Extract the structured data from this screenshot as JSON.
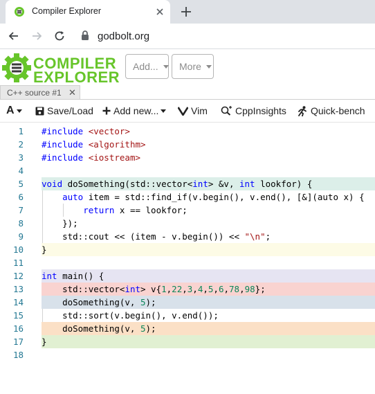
{
  "browser": {
    "tab_title": "Compiler Explorer",
    "url": "godbolt.org"
  },
  "header": {
    "logo_line1": "COMPILER",
    "logo_line2": "EXPLORER",
    "add_label": "Add...",
    "more_label": "More"
  },
  "pane": {
    "tab_label": "C++ source #1",
    "tab_close": "✕"
  },
  "toolbar": {
    "font_label": "A",
    "save_label": "Save/Load",
    "addnew_label": "Add new...",
    "vim_label": "Vim",
    "cppinsights_label": "CppInsights",
    "quickbench_label": "Quick-bench"
  },
  "colors": {
    "accent_green": "#67c52a",
    "line_numbers": "#237893",
    "keyword": "#0000ff",
    "string": "#a31515",
    "number": "#098658"
  },
  "editor": {
    "lines": [
      {
        "n": "1",
        "bg": "",
        "tokens": [
          [
            "dir",
            "#include "
          ],
          [
            "inc",
            "<vector>"
          ]
        ]
      },
      {
        "n": "2",
        "bg": "",
        "tokens": [
          [
            "dir",
            "#include "
          ],
          [
            "inc",
            "<algorithm>"
          ]
        ]
      },
      {
        "n": "3",
        "bg": "",
        "tokens": [
          [
            "dir",
            "#include "
          ],
          [
            "inc",
            "<iostream>"
          ]
        ]
      },
      {
        "n": "4",
        "bg": "",
        "tokens": []
      },
      {
        "n": "5",
        "bg": "#dcefe9",
        "tokens": [
          [
            "kw",
            "void"
          ],
          [
            "fg",
            " doSomething(std::vector<"
          ],
          [
            "kw",
            "int"
          ],
          [
            "fg",
            "> &v, "
          ],
          [
            "kw",
            "int"
          ],
          [
            "fg",
            " lookfor) {"
          ]
        ]
      },
      {
        "n": "6",
        "bg": "",
        "tokens": [
          [
            "fg",
            "    "
          ],
          [
            "kw",
            "auto"
          ],
          [
            "fg",
            " item = std::find_if(v.begin(), v.end(), [&](auto x) {"
          ]
        ]
      },
      {
        "n": "7",
        "bg": "",
        "tokens": [
          [
            "fg",
            "        "
          ],
          [
            "kw",
            "return"
          ],
          [
            "fg",
            " x == lookfor;"
          ]
        ]
      },
      {
        "n": "8",
        "bg": "",
        "tokens": [
          [
            "fg",
            "    });"
          ]
        ]
      },
      {
        "n": "9",
        "bg": "",
        "tokens": [
          [
            "fg",
            "    std::cout << (item - v.begin()) << "
          ],
          [
            "str",
            "\"\\n\""
          ],
          [
            "fg",
            ";"
          ]
        ]
      },
      {
        "n": "10",
        "bg": "#fdfbe6",
        "tokens": [
          [
            "fg",
            "}"
          ]
        ]
      },
      {
        "n": "11",
        "bg": "",
        "tokens": []
      },
      {
        "n": "12",
        "bg": "#e6e4f2",
        "tokens": [
          [
            "kw",
            "int"
          ],
          [
            "fg",
            " main() {"
          ]
        ]
      },
      {
        "n": "13",
        "bg": "#f9d3d0",
        "tokens": [
          [
            "fg",
            "    std::vector<"
          ],
          [
            "kw",
            "int"
          ],
          [
            "fg",
            "> v{"
          ],
          [
            "num",
            "1"
          ],
          [
            "fg",
            ","
          ],
          [
            "num",
            "22"
          ],
          [
            "fg",
            ","
          ],
          [
            "num",
            "3"
          ],
          [
            "fg",
            ","
          ],
          [
            "num",
            "4"
          ],
          [
            "fg",
            ","
          ],
          [
            "num",
            "5"
          ],
          [
            "fg",
            ","
          ],
          [
            "num",
            "6"
          ],
          [
            "fg",
            ","
          ],
          [
            "num",
            "78"
          ],
          [
            "fg",
            ","
          ],
          [
            "num",
            "98"
          ],
          [
            "fg",
            "};"
          ]
        ]
      },
      {
        "n": "14",
        "bg": "#d8e1ea",
        "tokens": [
          [
            "fg",
            "    doSomething(v, "
          ],
          [
            "num",
            "5"
          ],
          [
            "fg",
            ");"
          ]
        ]
      },
      {
        "n": "15",
        "bg": "",
        "tokens": [
          [
            "fg",
            "    std::sort(v.begin(), v.end());"
          ]
        ]
      },
      {
        "n": "16",
        "bg": "#fbe0c6",
        "tokens": [
          [
            "fg",
            "    doSomething(v, "
          ],
          [
            "num",
            "5"
          ],
          [
            "fg",
            ");"
          ]
        ]
      },
      {
        "n": "17",
        "bg": "#e1f0d2",
        "tokens": [
          [
            "fg",
            "}"
          ]
        ]
      },
      {
        "n": "18",
        "bg": "",
        "tokens": []
      }
    ]
  }
}
